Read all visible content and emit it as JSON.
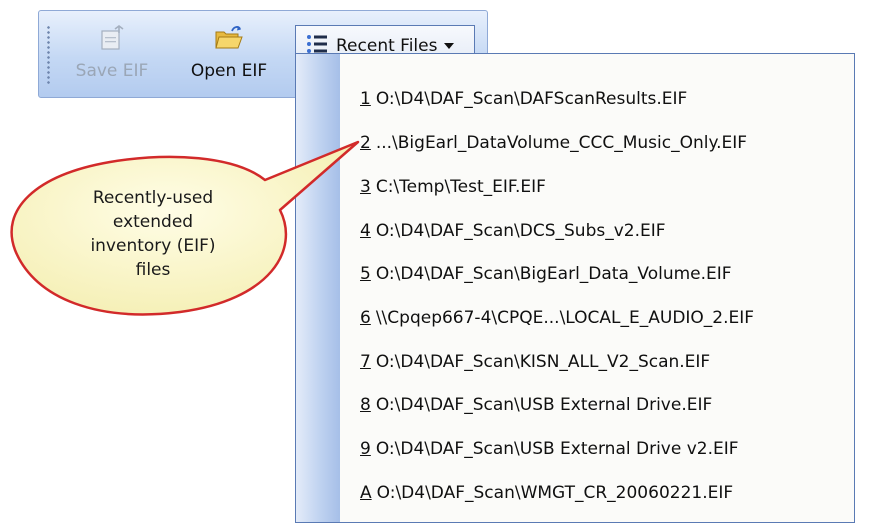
{
  "toolbar": {
    "save_label": "Save EIF",
    "open_label": "Open EIF",
    "recent_label": "Recent Files"
  },
  "menu": {
    "items": [
      {
        "accel": "1",
        "path": "O:\\D4\\DAF_Scan\\DAFScanResults.EIF"
      },
      {
        "accel": "2",
        "path": "...\\BigEarl_DataVolume_CCC_Music_Only.EIF"
      },
      {
        "accel": "3",
        "path": "C:\\Temp\\Test_EIF.EIF"
      },
      {
        "accel": "4",
        "path": "O:\\D4\\DAF_Scan\\DCS_Subs_v2.EIF"
      },
      {
        "accel": "5",
        "path": "O:\\D4\\DAF_Scan\\BigEarl_Data_Volume.EIF"
      },
      {
        "accel": "6",
        "path": "\\\\Cpqep667-4\\CPQE...\\LOCAL_E_AUDIO_2.EIF"
      },
      {
        "accel": "7",
        "path": "O:\\D4\\DAF_Scan\\KISN_ALL_V2_Scan.EIF"
      },
      {
        "accel": "8",
        "path": "O:\\D4\\DAF_Scan\\USB External Drive.EIF"
      },
      {
        "accel": "9",
        "path": "O:\\D4\\DAF_Scan\\USB External Drive v2.EIF"
      },
      {
        "accel": "A",
        "path": "O:\\D4\\DAF_Scan\\WMGT_CR_20060221.EIF"
      }
    ]
  },
  "callout": {
    "lines": [
      "Recently-used",
      "extended",
      "inventory (EIF)",
      "files"
    ]
  },
  "colors": {
    "toolbar_accent": "#c4d8f4",
    "menu_border": "#5a7ab4",
    "callout_fill": "#fbf7c6",
    "callout_stroke": "#d22a2a"
  },
  "icons": {
    "save": "save-document-icon",
    "open": "open-folder-icon",
    "recent": "list-icon",
    "dropdown": "caret-down-icon"
  }
}
